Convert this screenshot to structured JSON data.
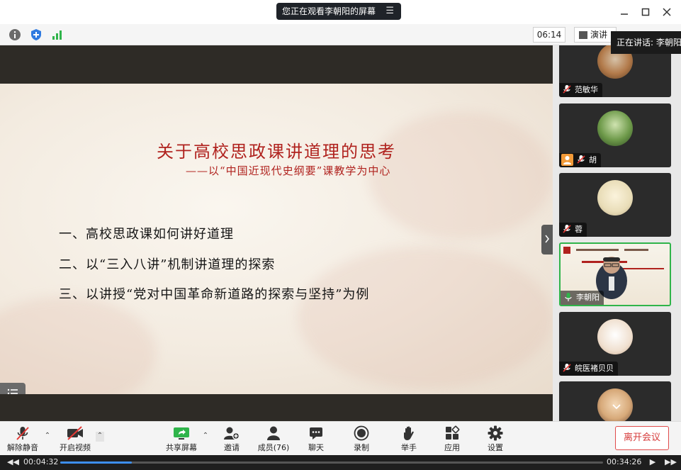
{
  "window": {
    "share_banner": "您正在观看李朝阳的屏幕",
    "minimize_icon": "minimize-icon",
    "maximize_icon": "maximize-icon",
    "close_icon": "close-icon"
  },
  "infobar": {
    "timer": "06:14",
    "view_label": "演讲",
    "speaking": "正在讲话: 李朝阳"
  },
  "slide": {
    "title": "关于高校思政课讲道理的思考",
    "subtitle": "——以“中国近现代史纲要”课教学为中心",
    "items": [
      "一、高校思政课如何讲好道理",
      "二、以“三入八讲”机制讲道理的探索",
      "三、以讲授“党对中国革命新道路的探索与坚持”为例"
    ]
  },
  "participants": [
    {
      "name": "范敏华",
      "muted": true,
      "host": false
    },
    {
      "name": "胡",
      "muted": true,
      "host": true
    },
    {
      "name": "蓉",
      "muted": true,
      "host": false
    },
    {
      "name": "李朝阳",
      "muted": false,
      "host": false,
      "active": true
    },
    {
      "name": "皖医褚贝贝",
      "muted": true,
      "host": false
    }
  ],
  "toolbar": {
    "unmute": "解除静音",
    "start_video": "开启视频",
    "share_screen": "共享屏幕",
    "invite": "邀请",
    "members": "成员(76)",
    "chat": "聊天",
    "record": "录制",
    "raise_hand": "举手",
    "apps": "应用",
    "settings": "设置",
    "leave": "离开会议"
  },
  "playback": {
    "current": "00:04:32",
    "total": "00:34:26",
    "progress": 0.132
  },
  "colors": {
    "accent_green": "#2fb44a",
    "title_red": "#b0221e",
    "leave_red": "#d63b3b",
    "progress_blue": "#3d8ef0"
  }
}
